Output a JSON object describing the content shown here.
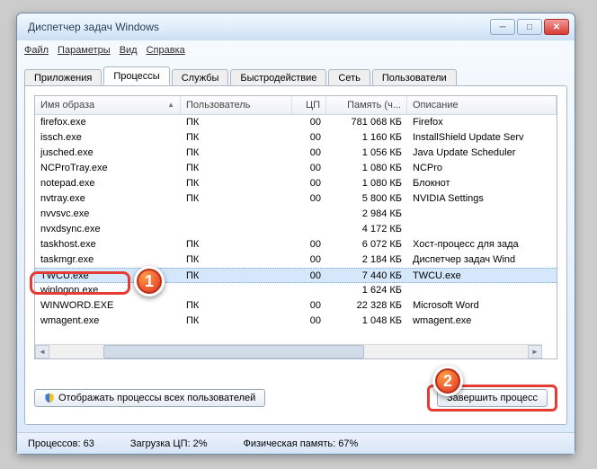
{
  "window": {
    "title": "Диспетчер задач Windows"
  },
  "menu": {
    "file": "Файл",
    "options": "Параметры",
    "view": "Вид",
    "help": "Справка"
  },
  "tabs": {
    "apps": "Приложения",
    "processes": "Процессы",
    "services": "Службы",
    "performance": "Быстродействие",
    "network": "Сеть",
    "users": "Пользователи"
  },
  "columns": {
    "image": "Имя образа",
    "user": "Пользователь",
    "cpu": "ЦП",
    "mem": "Память (ч...",
    "desc": "Описание"
  },
  "rows": [
    {
      "image": "firefox.exe",
      "user": "ПК",
      "cpu": "00",
      "mem": "781 068 КБ",
      "desc": "Firefox"
    },
    {
      "image": "issch.exe",
      "user": "ПК",
      "cpu": "00",
      "mem": "1 160 КБ",
      "desc": "InstallShield Update Serv"
    },
    {
      "image": "jusched.exe",
      "user": "ПК",
      "cpu": "00",
      "mem": "1 056 КБ",
      "desc": "Java Update Scheduler"
    },
    {
      "image": "NCProTray.exe",
      "user": "ПК",
      "cpu": "00",
      "mem": "1 080 КБ",
      "desc": "NCPro"
    },
    {
      "image": "notepad.exe",
      "user": "ПК",
      "cpu": "00",
      "mem": "1 080 КБ",
      "desc": "Блокнот"
    },
    {
      "image": "nvtray.exe",
      "user": "ПК",
      "cpu": "00",
      "mem": "5 800 КБ",
      "desc": "NVIDIA Settings"
    },
    {
      "image": "nvvsvc.exe",
      "user": "",
      "cpu": "",
      "mem": "2 984 КБ",
      "desc": ""
    },
    {
      "image": "nvxdsync.exe",
      "user": "",
      "cpu": "",
      "mem": "4 172 КБ",
      "desc": ""
    },
    {
      "image": "taskhost.exe",
      "user": "ПК",
      "cpu": "00",
      "mem": "6 072 КБ",
      "desc": "Хост-процесс для зада"
    },
    {
      "image": "taskmgr.exe",
      "user": "ПК",
      "cpu": "00",
      "mem": "2 184 КБ",
      "desc": "Диспетчер задач Wind"
    },
    {
      "image": "TWCU.exe",
      "user": "ПК",
      "cpu": "00",
      "mem": "7 440 КБ",
      "desc": "TWCU.exe",
      "selected": true
    },
    {
      "image": "winlogon.exe",
      "user": "",
      "cpu": "",
      "mem": "1 624 КБ",
      "desc": ""
    },
    {
      "image": "WINWORD.EXE",
      "user": "ПК",
      "cpu": "00",
      "mem": "22 328 КБ",
      "desc": "Microsoft Word"
    },
    {
      "image": "wmagent.exe",
      "user": "ПК",
      "cpu": "00",
      "mem": "1 048 КБ",
      "desc": "wmagent.exe"
    }
  ],
  "buttons": {
    "show_all_users": "Отображать процессы всех пользователей",
    "end_process": "Завершить процесс"
  },
  "status": {
    "procs_label": "Процессов:",
    "procs_value": "63",
    "cpu_label": "Загрузка ЦП:",
    "cpu_value": "2%",
    "mem_label": "Физическая память:",
    "mem_value": "67%"
  },
  "markers": {
    "one": "1",
    "two": "2"
  }
}
